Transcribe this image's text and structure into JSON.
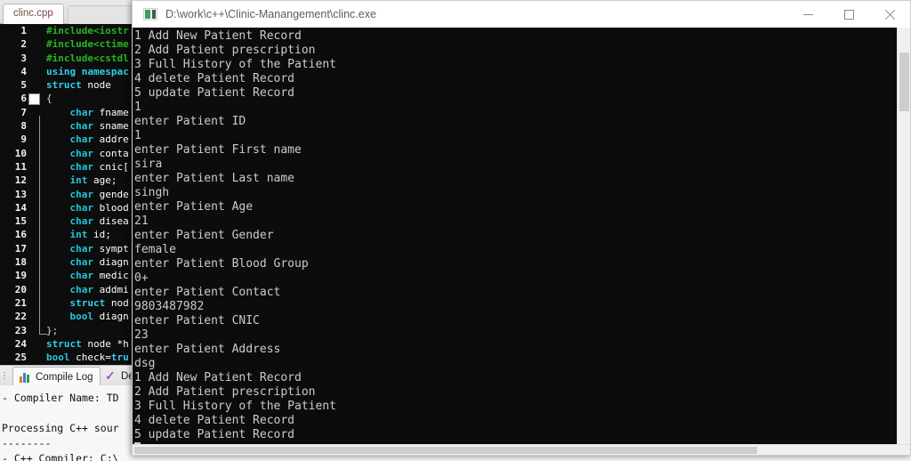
{
  "ide": {
    "editor_tab": {
      "label": "clinc.cpp"
    },
    "code_lines": [
      {
        "n": "1",
        "tokens": [
          {
            "t": "pre",
            "s": "#include<iostr"
          }
        ]
      },
      {
        "n": "2",
        "tokens": [
          {
            "t": "pre",
            "s": "#include<ctime"
          }
        ]
      },
      {
        "n": "3",
        "tokens": [
          {
            "t": "pre",
            "s": "#include<cstdl"
          }
        ]
      },
      {
        "n": "4",
        "tokens": [
          {
            "t": "key",
            "s": "using namespac"
          }
        ]
      },
      {
        "n": "5",
        "tokens": [
          {
            "t": "key",
            "s": "struct "
          },
          {
            "t": "id",
            "s": "node"
          }
        ]
      },
      {
        "n": "6",
        "tokens": [
          {
            "t": "punct",
            "s": "{"
          }
        ],
        "fold": true
      },
      {
        "n": "7",
        "tokens": [
          {
            "t": "punct",
            "s": "    "
          },
          {
            "t": "type",
            "s": "char "
          },
          {
            "t": "id",
            "s": "fname"
          }
        ]
      },
      {
        "n": "8",
        "tokens": [
          {
            "t": "punct",
            "s": "    "
          },
          {
            "t": "type",
            "s": "char "
          },
          {
            "t": "id",
            "s": "sname"
          }
        ]
      },
      {
        "n": "9",
        "tokens": [
          {
            "t": "punct",
            "s": "    "
          },
          {
            "t": "type",
            "s": "char "
          },
          {
            "t": "id",
            "s": "addre"
          }
        ]
      },
      {
        "n": "10",
        "tokens": [
          {
            "t": "punct",
            "s": "    "
          },
          {
            "t": "type",
            "s": "char "
          },
          {
            "t": "id",
            "s": "conta"
          }
        ]
      },
      {
        "n": "11",
        "tokens": [
          {
            "t": "punct",
            "s": "    "
          },
          {
            "t": "type",
            "s": "char "
          },
          {
            "t": "id",
            "s": "cnic["
          }
        ]
      },
      {
        "n": "12",
        "tokens": [
          {
            "t": "punct",
            "s": "    "
          },
          {
            "t": "type",
            "s": "int "
          },
          {
            "t": "id",
            "s": "age;"
          }
        ]
      },
      {
        "n": "13",
        "tokens": [
          {
            "t": "punct",
            "s": "    "
          },
          {
            "t": "type",
            "s": "char "
          },
          {
            "t": "id",
            "s": "gende"
          }
        ]
      },
      {
        "n": "14",
        "tokens": [
          {
            "t": "punct",
            "s": "    "
          },
          {
            "t": "type",
            "s": "char "
          },
          {
            "t": "id",
            "s": "blood"
          }
        ]
      },
      {
        "n": "15",
        "tokens": [
          {
            "t": "punct",
            "s": "    "
          },
          {
            "t": "type",
            "s": "char "
          },
          {
            "t": "id",
            "s": "disea"
          }
        ]
      },
      {
        "n": "16",
        "tokens": [
          {
            "t": "punct",
            "s": "    "
          },
          {
            "t": "type",
            "s": "int "
          },
          {
            "t": "id",
            "s": "id;"
          }
        ]
      },
      {
        "n": "17",
        "tokens": [
          {
            "t": "punct",
            "s": "    "
          },
          {
            "t": "type",
            "s": "char "
          },
          {
            "t": "id",
            "s": "sympt"
          }
        ]
      },
      {
        "n": "18",
        "tokens": [
          {
            "t": "punct",
            "s": "    "
          },
          {
            "t": "type",
            "s": "char "
          },
          {
            "t": "id",
            "s": "diagn"
          }
        ]
      },
      {
        "n": "19",
        "tokens": [
          {
            "t": "punct",
            "s": "    "
          },
          {
            "t": "type",
            "s": "char "
          },
          {
            "t": "id",
            "s": "medic"
          }
        ]
      },
      {
        "n": "20",
        "tokens": [
          {
            "t": "punct",
            "s": "    "
          },
          {
            "t": "type",
            "s": "char "
          },
          {
            "t": "id",
            "s": "addmi"
          }
        ]
      },
      {
        "n": "21",
        "tokens": [
          {
            "t": "punct",
            "s": "    "
          },
          {
            "t": "key",
            "s": "struct "
          },
          {
            "t": "id",
            "s": "nod"
          }
        ]
      },
      {
        "n": "22",
        "tokens": [
          {
            "t": "punct",
            "s": "    "
          },
          {
            "t": "type",
            "s": "bool "
          },
          {
            "t": "id",
            "s": "diagn"
          }
        ]
      },
      {
        "n": "23",
        "tokens": [
          {
            "t": "punct",
            "s": "};"
          }
        ]
      },
      {
        "n": "24",
        "tokens": [
          {
            "t": "key",
            "s": "struct "
          },
          {
            "t": "id",
            "s": "node *h"
          }
        ]
      },
      {
        "n": "25",
        "tokens": [
          {
            "t": "type",
            "s": "bool "
          },
          {
            "t": "id",
            "s": "check="
          },
          {
            "t": "key",
            "s": "tru"
          }
        ]
      }
    ],
    "log_tabs": [
      {
        "label": "Compile Log",
        "icon": "bar-chart-icon",
        "active": true
      },
      {
        "label": "De",
        "icon": "purple-check-icon",
        "active": false
      }
    ],
    "log_lines": [
      "- Compiler Name: TD",
      "",
      "Processing C++ sour",
      "--------",
      "- C++ Compiler: C:\\"
    ]
  },
  "console": {
    "title": "D:\\work\\c++\\Clinic-Manangement\\clinc.exe",
    "icon": "console-app-icon",
    "window_buttons": {
      "minimize": "minimize-button",
      "maximize": "maximize-button",
      "close": "close-button"
    },
    "output_lines": [
      "1 Add New Patient Record",
      "2 Add Patient prescription",
      "3 Full History of the Patient",
      "4 delete Patient Record",
      "5 update Patient Record",
      "1",
      "enter Patient ID",
      "1",
      "enter Patient First name",
      "sira",
      "enter Patient Last name",
      "singh",
      "enter Patient Age",
      "21",
      "enter Patient Gender",
      "female",
      "enter Patient Blood Group",
      "0+",
      "enter Patient Contact",
      "9803487982",
      "enter Patient CNIC",
      "23",
      "enter Patient Address",
      "dsg",
      "1 Add New Patient Record",
      "2 Add Patient prescription",
      "3 Full History of the Patient",
      "4 delete Patient Record",
      "5 update Patient Record"
    ]
  },
  "colors": {
    "console_bg": "#0c0c0c",
    "console_fg": "#cccccc",
    "editor_bg": "#0d0d0d",
    "preprocessor": "#23b723",
    "keyword": "#2fd0e8",
    "identifier": "#ffffff",
    "ide_chrome": "#f0f0f0"
  }
}
